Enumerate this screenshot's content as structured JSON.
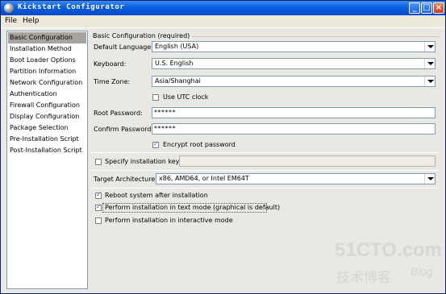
{
  "window": {
    "title": "Kickstart Configurator",
    "minimize_glyph": "_",
    "maximize_glyph": "□",
    "close_glyph": "×"
  },
  "menu": {
    "file": "File",
    "help": "Help"
  },
  "sidebar": {
    "items": [
      {
        "label": "Basic Configuration"
      },
      {
        "label": "Installation Method"
      },
      {
        "label": "Boot Loader Options"
      },
      {
        "label": "Partition Information"
      },
      {
        "label": "Network Configuration"
      },
      {
        "label": "Authentication"
      },
      {
        "label": "Firewall Configuration"
      },
      {
        "label": "Display Configuration"
      },
      {
        "label": "Package Selection"
      },
      {
        "label": "Pre-Installation Script"
      },
      {
        "label": "Post-Installation Script"
      }
    ],
    "selected_index": 0
  },
  "basic": {
    "section_title": "Basic Configuration (required)",
    "default_language_label": "Default Language:",
    "default_language_value": "English (USA)",
    "keyboard_label": "Keyboard:",
    "keyboard_value": "U.S. English",
    "timezone_label": "Time Zone:",
    "timezone_value": "Asia/Shanghai",
    "utc_clock_label": "Use UTC clock",
    "utc_clock_checked": false,
    "root_password_label": "Root Password:",
    "root_password_value": "******",
    "confirm_password_label": "Confirm Password:",
    "confirm_password_value": "******",
    "encrypt_label": "Encrypt root password",
    "encrypt_checked": true,
    "install_key_label": "Specify installation key:",
    "install_key_checked": false,
    "install_key_value": "",
    "target_arch_label": "Target Architecture:",
    "target_arch_value": "x86, AMD64, or Intel EM64T",
    "reboot_label": "Reboot system after installation",
    "reboot_checked": true,
    "text_mode_label": "Perform installation in text mode (graphical is default)",
    "text_mode_checked": true,
    "interactive_label": "Perform installation in interactive mode",
    "interactive_checked": false
  },
  "watermark": {
    "site": "51CTO.com",
    "tagline": "技术博客",
    "blog": "Blog"
  }
}
